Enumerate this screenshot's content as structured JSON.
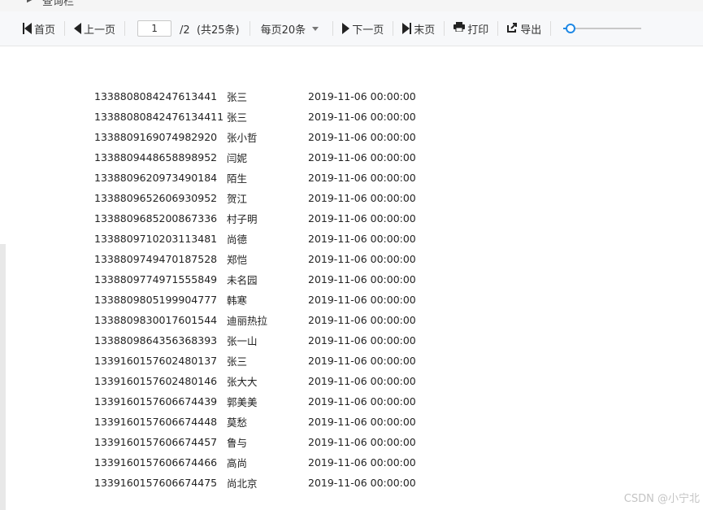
{
  "topbar": {
    "title": "查询栏"
  },
  "toolbar": {
    "first": "首页",
    "prev": "上一页",
    "current_page": "1",
    "total": "/2  (共25条)",
    "page_size": "每页20条",
    "next": "下一页",
    "last": "末页",
    "print": "打印",
    "export": "导出",
    "zoom_fraction": 0.05
  },
  "rows": [
    [
      "1338808084247613441",
      "张三",
      "2019-11-06 00:00:00"
    ],
    [
      "13388080842476134411",
      "张三",
      "2019-11-06 00:00:00"
    ],
    [
      "1338809169074982920",
      "张小哲",
      "2019-11-06 00:00:00"
    ],
    [
      "1338809448658898952",
      "闫妮",
      "2019-11-06 00:00:00"
    ],
    [
      "1338809620973490184",
      "陌生",
      "2019-11-06 00:00:00"
    ],
    [
      "1338809652606930952",
      "贺江",
      "2019-11-06 00:00:00"
    ],
    [
      "1338809685200867336",
      "村子明",
      "2019-11-06 00:00:00"
    ],
    [
      "1338809710203113481",
      "尚德",
      "2019-11-06 00:00:00"
    ],
    [
      "1338809749470187528",
      "郑恺",
      "2019-11-06 00:00:00"
    ],
    [
      "1338809774971555849",
      "未名园",
      "2019-11-06 00:00:00"
    ],
    [
      "1338809805199904777",
      "韩寒",
      "2019-11-06 00:00:00"
    ],
    [
      "1338809830017601544",
      "迪丽热拉",
      "2019-11-06 00:00:00"
    ],
    [
      "1338809864356368393",
      "张一山",
      "2019-11-06 00:00:00"
    ],
    [
      "1339160157602480137",
      "张三",
      "2019-11-06 00:00:00"
    ],
    [
      "1339160157602480146",
      "张大大",
      "2019-11-06 00:00:00"
    ],
    [
      "1339160157606674439",
      "郭美美",
      "2019-11-06 00:00:00"
    ],
    [
      "1339160157606674448",
      "莫愁",
      "2019-11-06 00:00:00"
    ],
    [
      "1339160157606674457",
      "鲁与",
      "2019-11-06 00:00:00"
    ],
    [
      "1339160157606674466",
      "高尚",
      "2019-11-06 00:00:00"
    ],
    [
      "1339160157606674475",
      "尚北京",
      "2019-11-06 00:00:00"
    ]
  ],
  "watermark": "CSDN @小宁北",
  "colors": {
    "accent": "#1e88e5",
    "toolbar_bg": "#f7f8fa"
  },
  "icons": {
    "first": "skip-first-icon",
    "prev": "prev-arrow-icon",
    "next": "next-arrow-icon",
    "last": "skip-last-icon",
    "print": "printer-icon",
    "export": "export-icon",
    "collapse": "collapse-arrow-icon"
  }
}
